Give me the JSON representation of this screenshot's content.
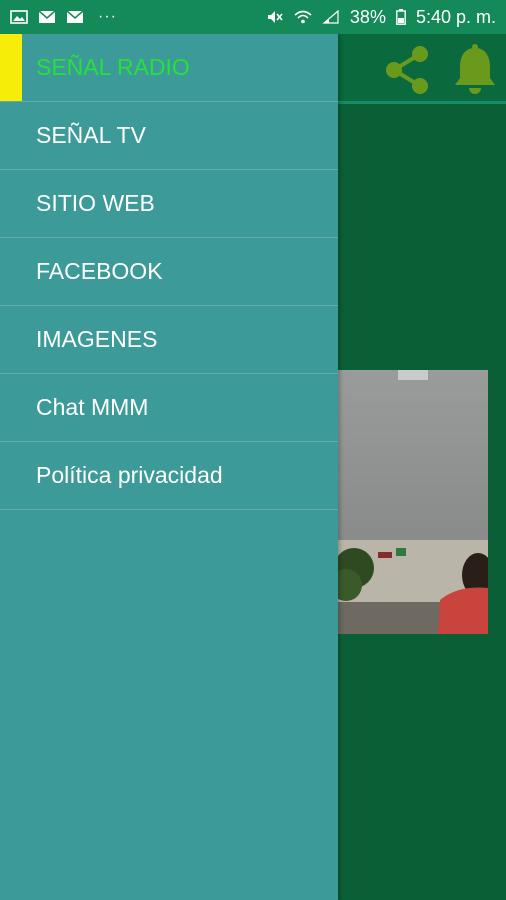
{
  "status_bar": {
    "notification_icons": [
      "image-icon",
      "mail-icon",
      "mail-icon"
    ],
    "more_indicator": "···",
    "battery": "38%",
    "time": "5:40 p. m."
  },
  "toolbar": {
    "icons": [
      "share-icon",
      "bell-icon"
    ],
    "icon_color": "#6a9a1c"
  },
  "drawer": {
    "items": [
      {
        "label": "SEÑAL RADIO",
        "active": true
      },
      {
        "label": "SEÑAL TV"
      },
      {
        "label": "SITIO WEB"
      },
      {
        "label": "FACEBOOK"
      },
      {
        "label": "IMAGENES"
      },
      {
        "label": "Chat MMM"
      },
      {
        "label": "Política privacidad"
      }
    ],
    "active_color": "#27e03a",
    "indicator_color": "#f6ee08",
    "background": "#3c9a99"
  },
  "colors": {
    "status_bar": "#138a58",
    "app_background": "#0a5f37"
  }
}
